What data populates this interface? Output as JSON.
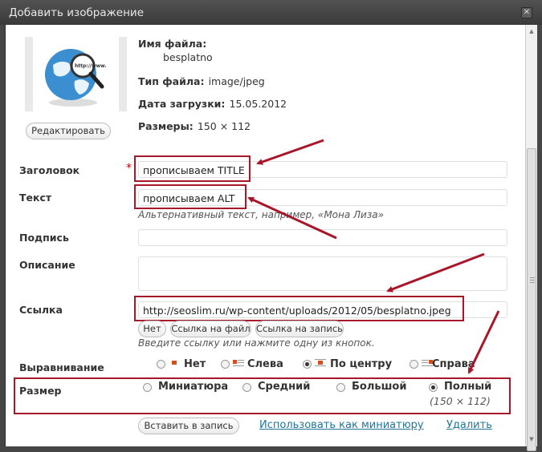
{
  "window": {
    "title": "Добавить изображение"
  },
  "file": {
    "name_label": "Имя файла:",
    "name_value": "besplatno",
    "type_label": "Тип файла:",
    "type_value": "image/jpeg",
    "date_label": "Дата загрузки:",
    "date_value": "15.05.2012",
    "size_label": "Размеры:",
    "size_value": "150 × 112",
    "edit_button": "Редактировать",
    "thumbnail_text": "http://www."
  },
  "form": {
    "title_label": "Заголовок",
    "required_mark": "*",
    "title_value": "прописываем TITLE",
    "alt_label": "Текст",
    "alt_value": "прописываем ALT",
    "alt_help": "Альтернативный текст, например, «Мона Лиза»",
    "caption_label": "Подпись",
    "caption_value": "",
    "description_label": "Описание",
    "description_value": "",
    "link_label": "Ссылка",
    "link_value": "http://seoslim.ru/wp-content/uploads/2012/05/besplatno.jpeg",
    "link_buttons": [
      "Нет",
      "Ссылка на файл",
      "Ссылка на запись"
    ],
    "link_help": "Введите ссылку или нажмите одну из кнопок.",
    "align_label": "Выравнивание",
    "align_options": [
      "Нет",
      "Слева",
      "По центру",
      "Справа"
    ],
    "align_selected": "По центру",
    "size_label": "Размер",
    "size_options": [
      "Миниатюра",
      "Средний",
      "Большой",
      "Полный"
    ],
    "size_selected": "Полный",
    "size_full_dims": "(150 × 112)"
  },
  "actions": {
    "insert_button": "Вставить в запись",
    "use_thumbnail_link": "Использовать как миниатюру",
    "delete_link": "Удалить"
  },
  "colors": {
    "annotation_red": "#a8162a",
    "link_blue": "#21759b",
    "titlebar": "#464646"
  }
}
